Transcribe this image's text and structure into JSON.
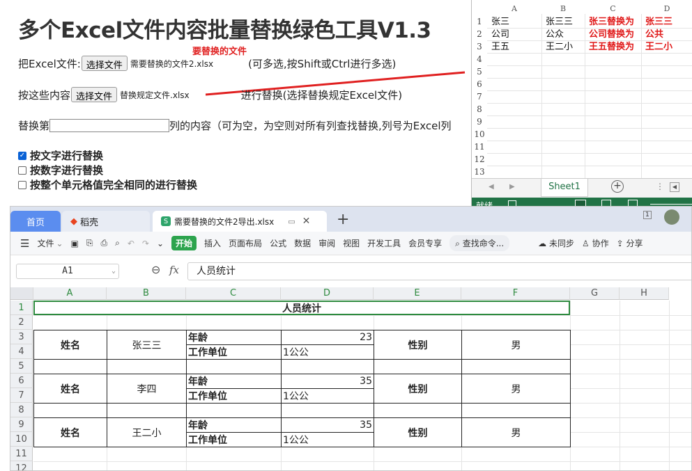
{
  "tool": {
    "title": "多个Excel文件内容批量替换绿色工具V1.3",
    "row1_prefix": "把Excel文件:",
    "choose_file_label": "选择文件",
    "row1_file": "需要替换的文件2.xlsx",
    "row1_hint": "(可多选,按Shift或Ctrl进行多选)",
    "row2_prefix": "按这些内容",
    "row2_file": "替换规定文件.xlsx",
    "row2_hint": "进行替换(选择替换规定Excel文件)",
    "row3_prefix": "替换第",
    "row3_suffix": "列的内容（可为空，为空则对所有列查找替换,列号为Excel列",
    "col_input_value": "",
    "options": [
      {
        "label": "按文字进行替换",
        "checked": true
      },
      {
        "label": "按数字进行替换",
        "checked": false
      },
      {
        "label": "按整个单元格值完全相同的进行替换",
        "checked": false
      }
    ],
    "annotation": "要替换的文件",
    "annotation_color": "#e02020"
  },
  "mini_excel": {
    "columns": [
      "A",
      "B",
      "C",
      "D"
    ],
    "rows": [
      "1",
      "2",
      "3",
      "4",
      "5",
      "6",
      "7",
      "8",
      "9",
      "10",
      "11",
      "12",
      "13"
    ],
    "cells": [
      {
        "row": 1,
        "col": "A",
        "text": "张三"
      },
      {
        "row": 1,
        "col": "B",
        "text": "张三三"
      },
      {
        "row": 1,
        "col": "C",
        "text": "张三替换为",
        "red": true
      },
      {
        "row": 1,
        "col": "D",
        "text": "张三三",
        "red": true
      },
      {
        "row": 2,
        "col": "A",
        "text": "公司"
      },
      {
        "row": 2,
        "col": "B",
        "text": "公众"
      },
      {
        "row": 2,
        "col": "C",
        "text": "公司替换为",
        "red": true
      },
      {
        "row": 2,
        "col": "D",
        "text": "公共",
        "red": true
      },
      {
        "row": 3,
        "col": "A",
        "text": "王五"
      },
      {
        "row": 3,
        "col": "B",
        "text": "王二小"
      },
      {
        "row": 3,
        "col": "C",
        "text": "王五替换为",
        "red": true
      },
      {
        "row": 3,
        "col": "D",
        "text": "王二小",
        "red": true
      }
    ],
    "sheet_tab": "Sheet1",
    "status_ready": "就绪",
    "accent": "#217346"
  },
  "wps": {
    "tabs": {
      "home": "首页",
      "docer": "稻壳",
      "file": "需要替换的文件2导出.xlsx"
    },
    "toolbar": {
      "file_menu": "文件",
      "start": "开始",
      "items": [
        "插入",
        "页面布局",
        "公式",
        "数据",
        "审阅",
        "视图",
        "开发工具",
        "会员专享"
      ],
      "search": "查找命令...",
      "sync": "未同步",
      "collab": "协作",
      "share": "分享"
    },
    "namebox": "A1",
    "fx_label": "fx",
    "formula_value": "人员统计",
    "columns": [
      "A",
      "B",
      "C",
      "D",
      "E",
      "F",
      "G",
      "H"
    ],
    "rows": [
      "1",
      "2",
      "3",
      "4",
      "5",
      "6",
      "7",
      "8",
      "9",
      "10",
      "11",
      "12"
    ],
    "sheet": {
      "title": "人员统计",
      "records": [
        {
          "name_label": "姓名",
          "name": "张三三",
          "age_label": "年龄",
          "age": "23",
          "work_label": "工作单位",
          "work": "1公公",
          "gender_label": "性别",
          "gender": "男"
        },
        {
          "name_label": "姓名",
          "name": "李四",
          "age_label": "年龄",
          "age": "35",
          "work_label": "工作单位",
          "work": "1公公",
          "gender_label": "性别",
          "gender": "男"
        },
        {
          "name_label": "姓名",
          "name": "王二小",
          "age_label": "年龄",
          "age": "35",
          "work_label": "工作单位",
          "work": "1公公",
          "gender_label": "性别",
          "gender": "男"
        }
      ]
    },
    "accent": "#2d8a3e",
    "tab_active_color": "#5b8def"
  }
}
